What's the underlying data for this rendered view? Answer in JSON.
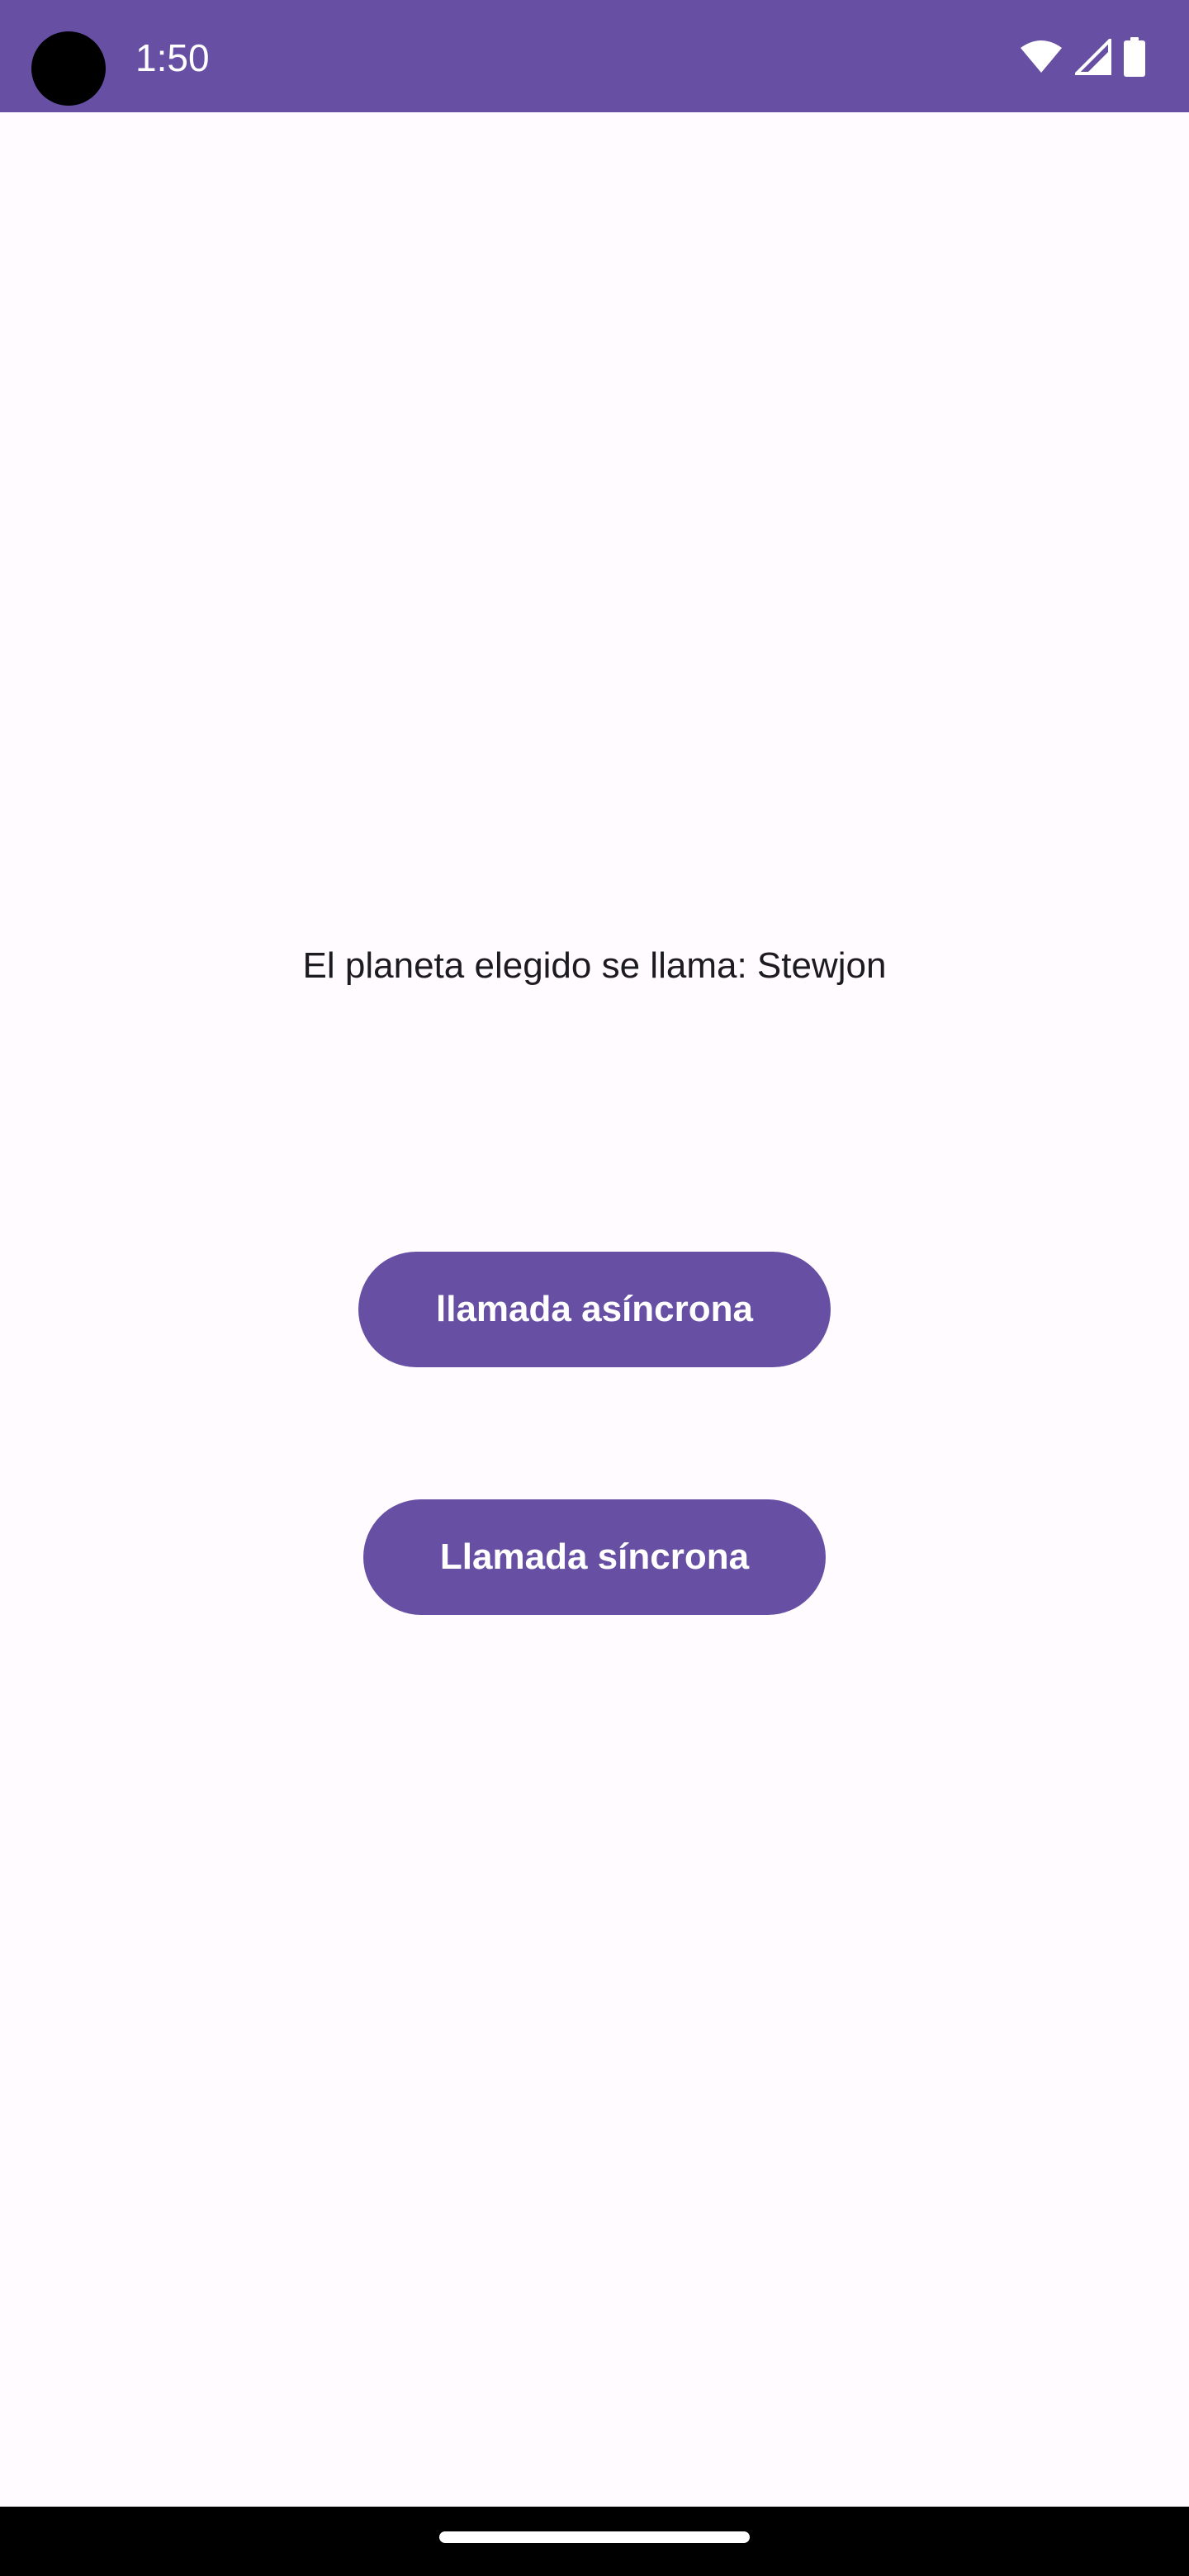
{
  "status_bar": {
    "time": "1:50",
    "background_color": "#6750A4",
    "icons": [
      "wifi-icon",
      "cellular-signal-icon",
      "battery-icon"
    ]
  },
  "main": {
    "planet_text": "El planeta elegido se llama: Stewjon",
    "async_button_label": "llamada asíncrona",
    "sync_button_label": "Llamada síncrona"
  },
  "colors": {
    "primary": "#6750A4",
    "background": "#FFFBFE",
    "text": "#1C1B1F",
    "nav_bar": "#000000"
  }
}
